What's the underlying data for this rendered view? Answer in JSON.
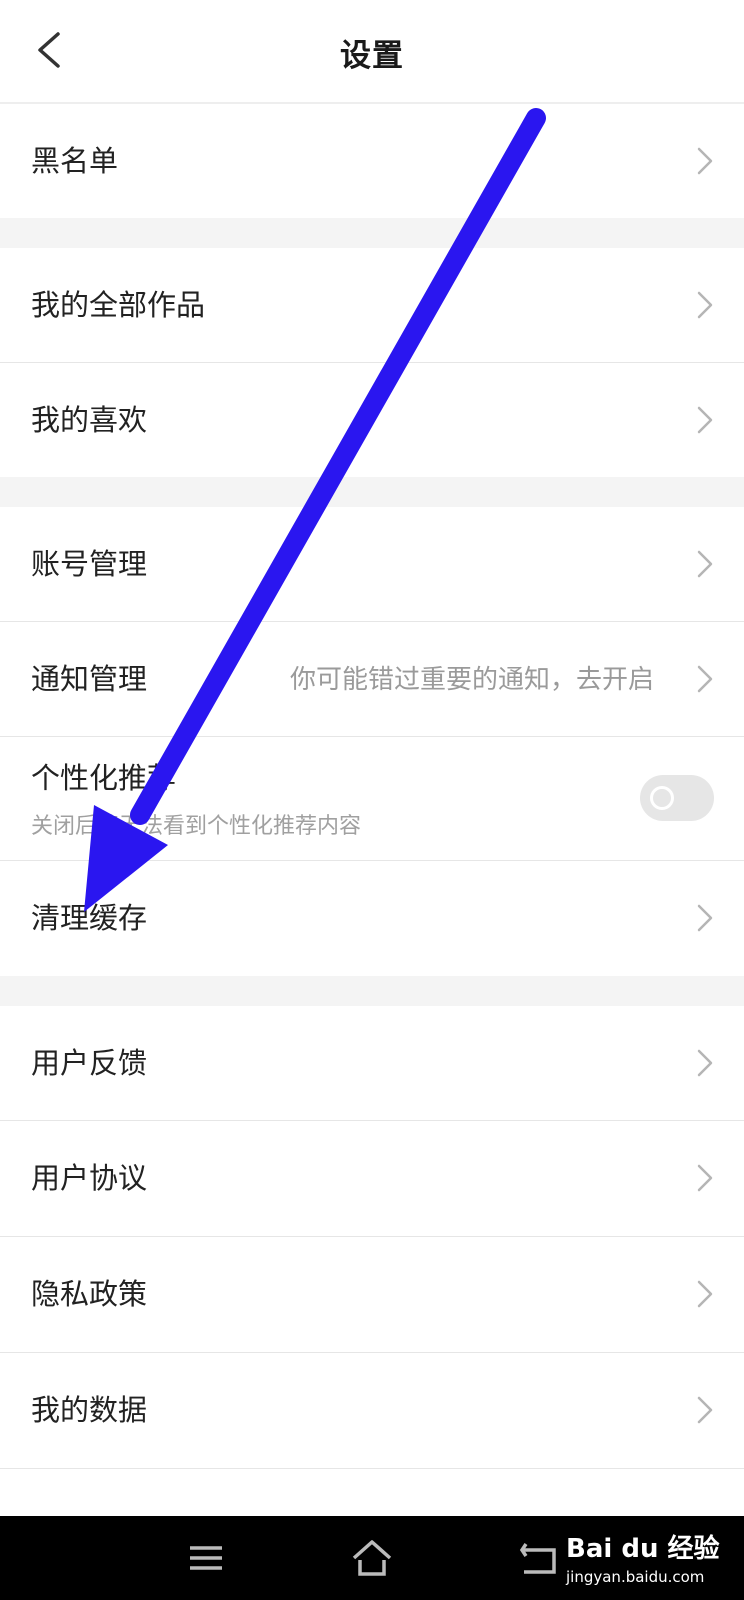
{
  "header": {
    "title": "设置",
    "back_icon": "chevron-left-icon"
  },
  "sections": {
    "blacklist": "黑名单",
    "my_works": "我的全部作品",
    "my_likes": "我的喜欢",
    "account": "账号管理",
    "notifications": "通知管理",
    "notifications_hint": "你可能错过重要的通知，去开启",
    "personalized": "个性化推荐",
    "personalized_sub": "关闭后将无法看到个性化推荐内容",
    "personalized_enabled": false,
    "clear_cache": "清理缓存",
    "feedback": "用户反馈",
    "agreement": "用户协议",
    "privacy": "隐私政策",
    "my_data": "我的数据"
  },
  "navbar": {
    "menu_icon": "menu-icon",
    "home_icon": "home-icon",
    "back_icon": "back-icon"
  },
  "watermark": {
    "brand": "Bai du 经验",
    "url": "jingyan.baidu.com"
  },
  "colors": {
    "arrow": "#2a16f0",
    "background": "#ffffff",
    "gap": "#f4f4f4"
  }
}
